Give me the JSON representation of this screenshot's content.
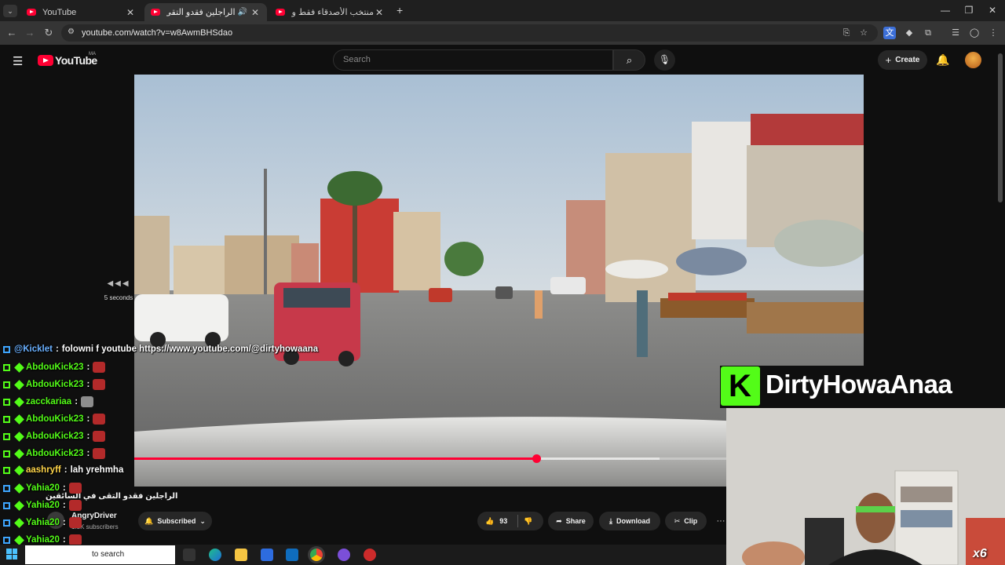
{
  "browser": {
    "tabs": [
      {
        "title": "YouTube",
        "active": false
      },
      {
        "title": "الراجلين فقدو التقى في السا",
        "active": true
      },
      {
        "title": "منتخب الأصدقاء فقط ولا مكان لـ",
        "active": false
      }
    ],
    "new_tab": "+",
    "url": "youtube.com/watch?v=w8AwmBHSdao",
    "window_controls": {
      "minimize": "—",
      "restore": "❐",
      "close": "✕"
    }
  },
  "youtube": {
    "logo": "YouTube",
    "region": "MA",
    "search_placeholder": "Search",
    "create_label": "Create"
  },
  "player": {
    "seek_hint": "5 seconds",
    "progress_percent": 68
  },
  "video_info": {
    "title": "الراجلين فقدو التقى في السائقين",
    "channel_name": "AngryDriver",
    "subscribers": "1.3K subscribers",
    "subscribed_label": "Subscribed",
    "likes": "93",
    "share_label": "Share",
    "download_label": "Download",
    "clip_label": "Clip",
    "more_label": "···"
  },
  "chat": [
    {
      "user": "@Kicklet",
      "msg": "folowni f youtube https://www.youtube.com/@dirtyhowaana",
      "emote": "",
      "color": "blue"
    },
    {
      "user": "AbdouKick23",
      "msg": "",
      "emote": "red",
      "color": "green"
    },
    {
      "user": "AbdouKick23",
      "msg": "",
      "emote": "red",
      "color": "green"
    },
    {
      "user": "zacckariaa",
      "msg": "",
      "emote": "gray",
      "color": "green"
    },
    {
      "user": "AbdouKick23",
      "msg": "",
      "emote": "red",
      "color": "green"
    },
    {
      "user": "AbdouKick23",
      "msg": "",
      "emote": "red",
      "color": "green"
    },
    {
      "user": "AbdouKick23",
      "msg": "",
      "emote": "red",
      "color": "green"
    },
    {
      "user": "aashryff",
      "msg": "lah yrehmha",
      "emote": "",
      "color": "gold"
    },
    {
      "user": "Yahia20",
      "msg": "",
      "emote": "red",
      "color": "green"
    },
    {
      "user": "Yahia20",
      "msg": "",
      "emote": "red",
      "color": "green"
    },
    {
      "user": "Yahia20",
      "msg": "",
      "emote": "red",
      "color": "green"
    },
    {
      "user": "Yahia20",
      "msg": "",
      "emote": "red",
      "color": "green"
    },
    {
      "user": "Yahia20",
      "msg": "",
      "emote": "red",
      "color": "green"
    }
  ],
  "overlay": {
    "kick_letter": "K",
    "brand_name": "DirtyHowaAnaa",
    "multiplier": "x6"
  },
  "taskbar": {
    "search_text": "to search"
  },
  "colors": {
    "youtube_red": "#ff0033",
    "kick_green": "#53fc18",
    "background": "#0f0f0f"
  }
}
